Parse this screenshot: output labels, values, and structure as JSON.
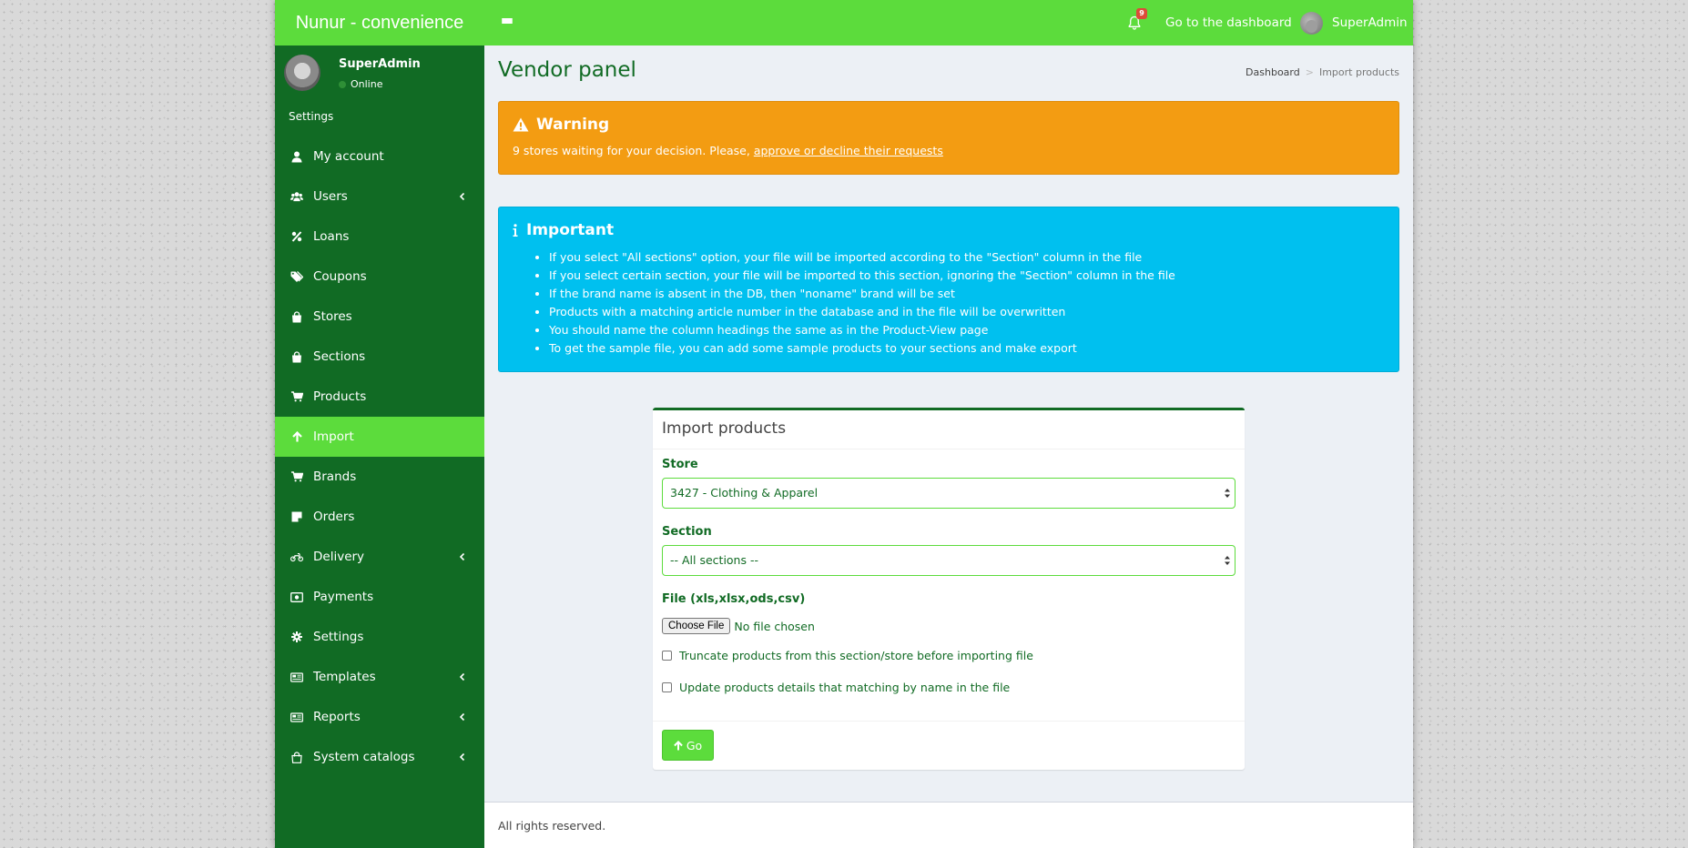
{
  "header": {
    "logo": "Nunur - convenience",
    "notification_count": "9",
    "dashboard_link": "Go to the dashboard",
    "user_name": "SuperAdmin"
  },
  "sidebar": {
    "user_name": "SuperAdmin",
    "user_status": "Online",
    "section_header": "Settings",
    "items": [
      {
        "label": "My account",
        "icon": "user-icon"
      },
      {
        "label": "Users",
        "icon": "users-icon"
      },
      {
        "label": "Loans",
        "icon": "percent-icon"
      },
      {
        "label": "Coupons",
        "icon": "tags-icon"
      },
      {
        "label": "Stores",
        "icon": "shopping-bag-icon"
      },
      {
        "label": "Sections",
        "icon": "shopping-bag-icon"
      },
      {
        "label": "Products",
        "icon": "cart-icon"
      },
      {
        "label": "Import",
        "icon": "arrow-up-icon"
      },
      {
        "label": "Brands",
        "icon": "cart-icon"
      },
      {
        "label": "Orders",
        "icon": "sticky-note-icon"
      },
      {
        "label": "Delivery",
        "icon": "motorcycle-icon"
      },
      {
        "label": "Payments",
        "icon": "money-icon"
      },
      {
        "label": "Settings",
        "icon": "gear-icon"
      },
      {
        "label": "Templates",
        "icon": "newspaper-icon"
      },
      {
        "label": "Reports",
        "icon": "newspaper-icon"
      },
      {
        "label": "System catalogs",
        "icon": "shopping-bag-outline-icon"
      }
    ]
  },
  "content": {
    "page_title": "Vendor panel",
    "breadcrumb": {
      "home": "Dashboard",
      "separator": ">",
      "current": "Import products"
    },
    "warning": {
      "title": "Warning",
      "text": "9 stores waiting for your decision. Please, ",
      "link": "approve or decline their requests"
    },
    "info": {
      "title": "Important",
      "items": [
        "If you select \"All sections\" option, your file will be imported according to the \"Section\" column in the file",
        "If you select certain section, your file will be imported to this section, ignoring the \"Section\" column in the file",
        "If the brand name is absent in the DB, then \"noname\" brand will be set",
        "Products with a matching article number in the database and in the file will be overwritten",
        "You should name the column headings the same as in the Product-View page",
        "To get the sample file, you can add some sample products to your sections and make export"
      ]
    },
    "import_box": {
      "title": "Import products",
      "store_label": "Store",
      "store_value": "3427 - Clothing & Apparel",
      "section_label": "Section",
      "section_value": "-- All sections --",
      "file_label": "File (xls,xlsx,ods,csv)",
      "file_button": "Choose File",
      "file_status": "No file chosen",
      "truncate_label": "Truncate products from this section/store before importing file",
      "update_label": "Update products details that matching by name in the file",
      "go_button": "Go"
    },
    "footer": "All rights reserved."
  },
  "colors": {
    "header": "#5cdc3c",
    "sidebar": "#116b24",
    "warning": "#f39c12",
    "info": "#00c0ef",
    "badge": "#dd4b39"
  }
}
